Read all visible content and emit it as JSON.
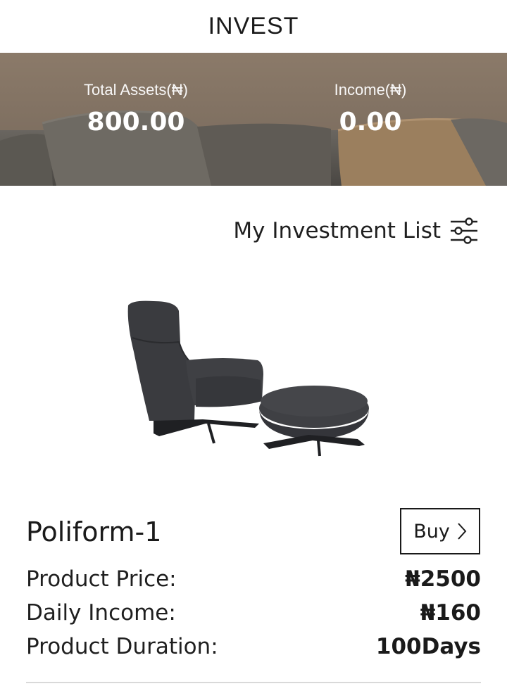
{
  "header": {
    "title": "INVEST"
  },
  "stats": {
    "total_assets": {
      "label": "Total Assets(₦)",
      "value": "800.00"
    },
    "income": {
      "label": "Income(₦)",
      "value": "0.00"
    }
  },
  "list": {
    "title": "My Investment List",
    "filter_icon": "filter-sliders-icon"
  },
  "product": {
    "name": "Poliform-1",
    "image": "armchair-with-ottoman",
    "buy_label": "Buy",
    "details": [
      {
        "label": "Product Price:",
        "value": "₦2500"
      },
      {
        "label": "Daily Income:",
        "value": "₦160"
      },
      {
        "label": "Product Duration:",
        "value": "100Days"
      }
    ]
  }
}
